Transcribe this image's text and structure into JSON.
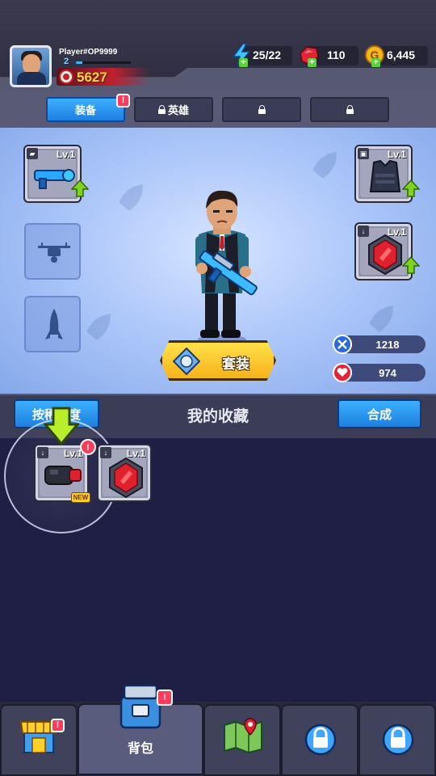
{
  "player": {
    "name": "Player#OP9999",
    "level": "2",
    "xp_progress": 0.12,
    "power": "5627"
  },
  "resources": {
    "energy": "25/22",
    "gems": "110",
    "coins": "6,445",
    "coin_symbol": "G"
  },
  "tabs": [
    {
      "label": "装备",
      "active": true,
      "badge": "!"
    },
    {
      "label": "英雄",
      "locked": true
    },
    {
      "label": "",
      "locked": true
    },
    {
      "label": "",
      "locked": true
    }
  ],
  "equipment": {
    "weapon_level": "Lv.1",
    "armor_level": "Lv.1",
    "accessory_level": "Lv.1"
  },
  "suit_button": {
    "label": "套装"
  },
  "stats": {
    "attack": "1218",
    "hp": "974"
  },
  "collection": {
    "sort_button": "按稀有度",
    "title": "我的收藏",
    "merge_button": "合成",
    "items": [
      {
        "level": "Lv.1",
        "is_new": true,
        "new_label": "NEW",
        "badge": "!"
      },
      {
        "level": "Lv.1"
      }
    ]
  },
  "bottom_nav": {
    "shop_badge": "!",
    "bag_label": "背包",
    "bag_badge": "!"
  },
  "colors": {
    "accent_blue": "#1d7fe0",
    "gold": "#f7b21a",
    "badge_red": "#ff3b5c",
    "upgrade_green": "#7ed321"
  }
}
